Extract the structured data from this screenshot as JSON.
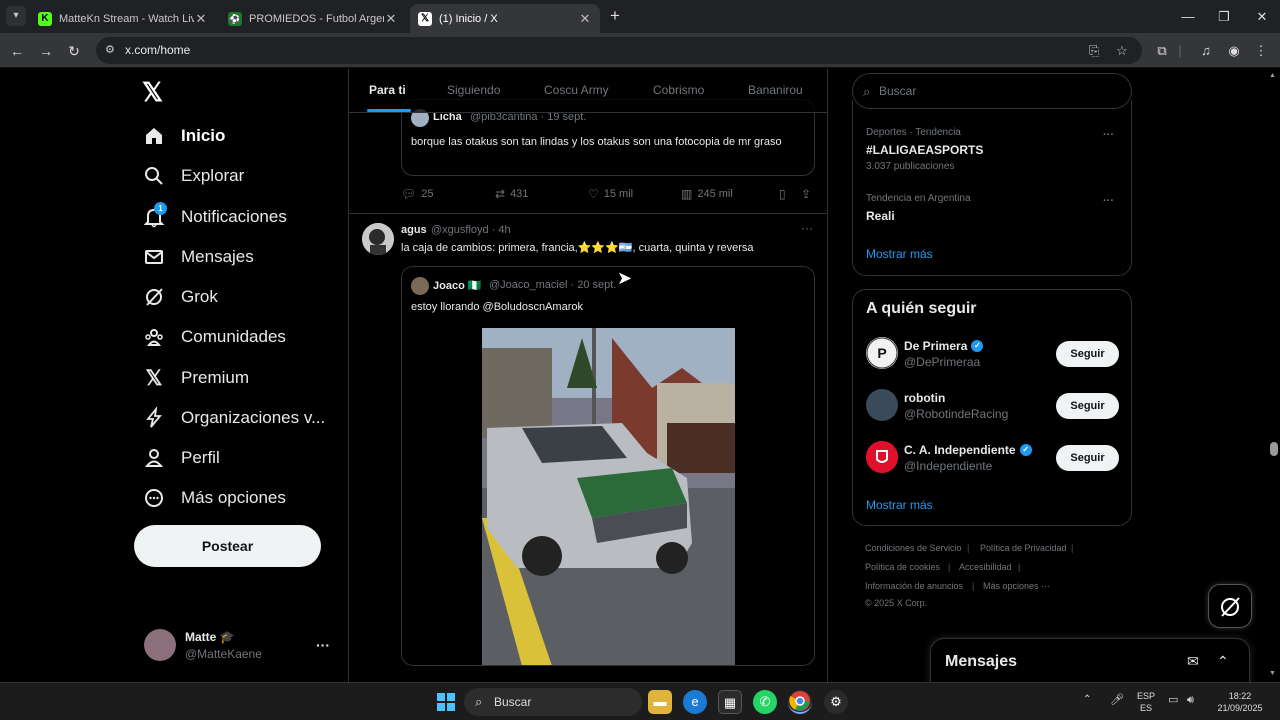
{
  "browser": {
    "tabs": [
      {
        "title": "MatteKn Stream - Watch Live o",
        "favicon": "K",
        "active": false
      },
      {
        "title": "PROMIEDOS - Futbol Argentino",
        "favicon": "⚽",
        "active": false
      },
      {
        "title": "(1) Inicio / X",
        "favicon": "𝕏",
        "active": true
      }
    ],
    "url": "x.com/home"
  },
  "nav": {
    "items": [
      {
        "label": "Inicio",
        "icon": "home-icon"
      },
      {
        "label": "Explorar",
        "icon": "search-icon"
      },
      {
        "label": "Notificaciones",
        "icon": "bell-icon",
        "badge": "1"
      },
      {
        "label": "Mensajes",
        "icon": "mail-icon"
      },
      {
        "label": "Grok",
        "icon": "grok-icon"
      },
      {
        "label": "Comunidades",
        "icon": "communities-icon"
      },
      {
        "label": "Premium",
        "icon": "x-icon"
      },
      {
        "label": "Organizaciones v...",
        "icon": "lightning-icon"
      },
      {
        "label": "Perfil",
        "icon": "person-icon"
      },
      {
        "label": "Más opciones",
        "icon": "more-circle-icon"
      }
    ],
    "post_label": "Postear",
    "me": {
      "name": "Matte 🎓",
      "handle": "@MatteKaene"
    }
  },
  "feed": {
    "tabs": [
      "Para ti",
      "Siguiendo",
      "Coscu Army",
      "Cobrismo",
      "Bananirou"
    ],
    "tweet1": {
      "quote": {
        "name": "Licha",
        "handle": "@pib3cantina · 19 sept.",
        "text": "borque las otakus son tan lindas y los otakus son una fotocopia de mr graso"
      },
      "stats": {
        "replies": "25",
        "reposts": "431",
        "likes": "15 mil",
        "views": "245 mil"
      }
    },
    "tweet2": {
      "name": "agus",
      "handle": "@xgusfloyd · 4h",
      "text": "la caja de cambios: primera, francia,⭐⭐⭐🇦🇷, cuarta, quinta y reversa",
      "quote": {
        "name": "Joaco 🇳🇬",
        "handle": "@Joaco_maciel · 20 sept.",
        "text": "estoy llorando @BoludoscnAmarok"
      }
    }
  },
  "right": {
    "search_placeholder": "Buscar",
    "trends": [
      {
        "meta": "Deportes · Tendencia",
        "name": "#LALIGAEASPORTS",
        "count": "3.037 publicaciones"
      },
      {
        "meta": "Tendencia en Argentina",
        "name": "Reali",
        "count": ""
      }
    ],
    "trends_more": "Mostrar más",
    "who_title": "A quién seguir",
    "who": [
      {
        "name": "De Primera",
        "handle": "@DePrimeraa",
        "verified": true,
        "button": "Seguir"
      },
      {
        "name": "robotin",
        "handle": "@RobotindeRacing",
        "verified": false,
        "button": "Seguir"
      },
      {
        "name": "C. A. Independiente",
        "handle": "@Independiente",
        "verified": true,
        "button": "Seguir"
      }
    ],
    "who_more": "Mostrar más",
    "footer": [
      "Condiciones de Servicio",
      "Política de Privacidad",
      "Política de cookies",
      "Accesibilidad",
      "Información de anuncios",
      "Más opciones ···",
      "© 2025 X Corp."
    ]
  },
  "messages_drawer": {
    "title": "Mensajes"
  },
  "taskbar": {
    "search_label": "Buscar",
    "lang": "ESP",
    "lang2": "ES",
    "time": "18:22",
    "date": "21/09/2025"
  }
}
